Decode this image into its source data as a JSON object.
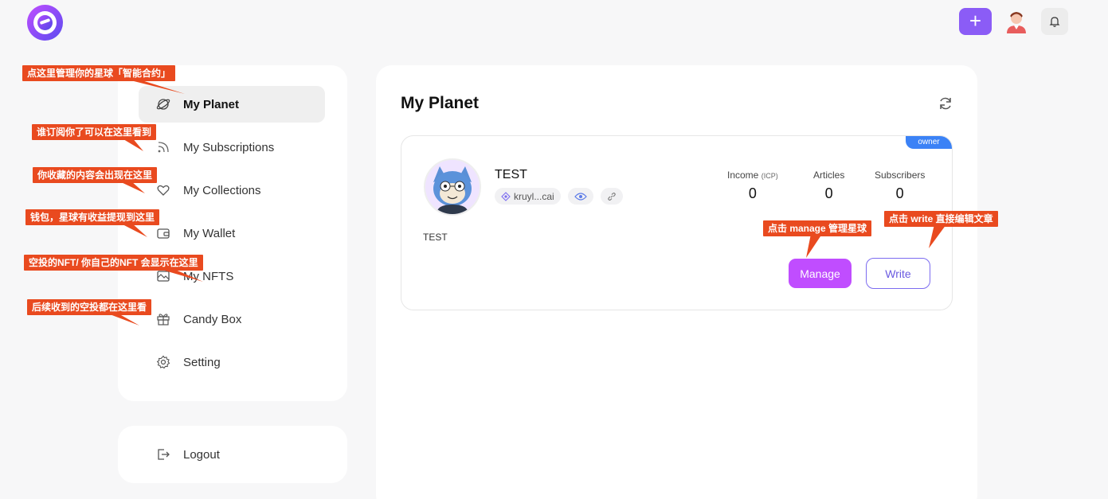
{
  "header": {
    "plus_label": "+"
  },
  "sidebar": {
    "items": [
      {
        "label": "My Planet",
        "icon": "planet-icon"
      },
      {
        "label": "My Subscriptions",
        "icon": "rss-icon"
      },
      {
        "label": "My Collections",
        "icon": "heart-icon"
      },
      {
        "label": "My Wallet",
        "icon": "wallet-icon"
      },
      {
        "label": "My NFTS",
        "icon": "nft-icon"
      },
      {
        "label": "Candy Box",
        "icon": "gift-icon"
      },
      {
        "label": "Setting",
        "icon": "gear-icon"
      }
    ],
    "logout_label": "Logout"
  },
  "main": {
    "title": "My Planet",
    "card": {
      "badge": "owner",
      "name": "TEST",
      "address": "kruyl...cai",
      "description": "TEST",
      "stats": [
        {
          "label": "Income",
          "unit": "(ICP)",
          "value": "0"
        },
        {
          "label": "Articles",
          "unit": "",
          "value": "0"
        },
        {
          "label": "Subscribers",
          "unit": "",
          "value": "0"
        }
      ],
      "manage_label": "Manage",
      "write_label": "Write"
    }
  },
  "annotations": [
    "点这里管理你的星球「智能合约」",
    "谁订阅你了可以在这里看到",
    "你收藏的内容会出现在这里",
    "钱包，星球有收益提现到这里",
    "空投的NFT/ 你自己的NFT 会显示在这里",
    "后续收到的空投都在这里看",
    "点击 manage 管理星球",
    "点击 write 直接编辑文章"
  ],
  "colors": {
    "accent_purple": "#8b5cf6",
    "manage_magenta": "#c04dff",
    "owner_blue": "#3b82f6",
    "annotation_red": "#e94a1f"
  }
}
